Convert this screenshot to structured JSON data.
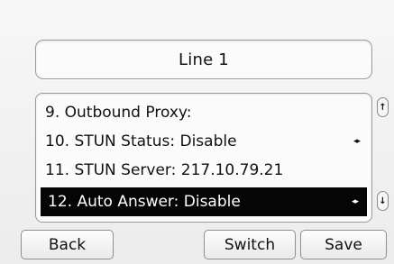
{
  "header": {
    "title": "Line 1"
  },
  "menu": {
    "items": [
      {
        "label": "9. Outbound Proxy:",
        "has_arrows": false,
        "selected": false
      },
      {
        "label": "10. STUN Status: Disable",
        "has_arrows": true,
        "selected": false
      },
      {
        "label": "11. STUN Server: 217.10.79.21",
        "has_arrows": false,
        "selected": false
      },
      {
        "label": "12. Auto Answer: Disable",
        "has_arrows": true,
        "selected": true
      }
    ],
    "arrow_glyph": "◂▸"
  },
  "scroll": {
    "up_glyph": "↑",
    "down_glyph": "↓"
  },
  "softkeys": {
    "back": "Back",
    "switch": "Switch",
    "save": "Save"
  },
  "colors": {
    "selection_bg": "#050505",
    "selection_text": "#ffffff",
    "border": "#9a9a9a"
  }
}
